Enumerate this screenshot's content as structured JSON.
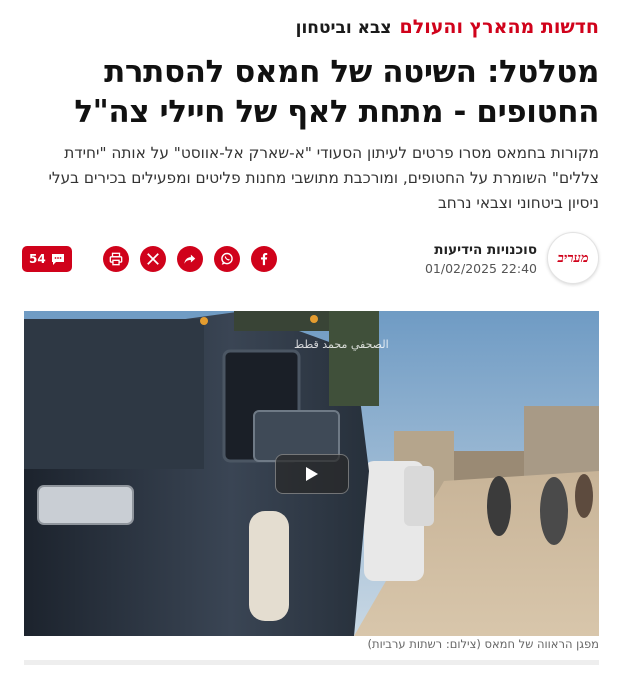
{
  "breadcrumb": {
    "section": "חדשות מהארץ והעולם",
    "subsection": "צבא וביטחון"
  },
  "article": {
    "headline": "מטלטל: השיטה של חמאס להסתרת החטופים - מתחת לאף של חיילי צה\"ל",
    "subtitle": "מקורות בחמאס מסרו פרטים לעיתון הסעודי \"א-שארק אל-אווסט\" על אותה \"יחידת צללים\" השומרת על החטופים, ומורכבת מתושבי מחנות פליטים ומפעילים בכירים בעלי ניסיון ביטחוני וצבאי נרחב"
  },
  "meta": {
    "logo_text": "מעריב",
    "author": "סוכנויות הידיעות",
    "date": "01/02/2025 22:40"
  },
  "actions": {
    "comments_count": "54",
    "buttons": [
      "facebook-icon",
      "whatsapp-icon",
      "share-icon",
      "x-icon",
      "print-icon"
    ],
    "accent_color": "#d0021b"
  },
  "media": {
    "watermark": "الصحفي محمد قطط",
    "caption": "מפגן הראווה של חמאס (צילום: רשתות ערביות)"
  }
}
